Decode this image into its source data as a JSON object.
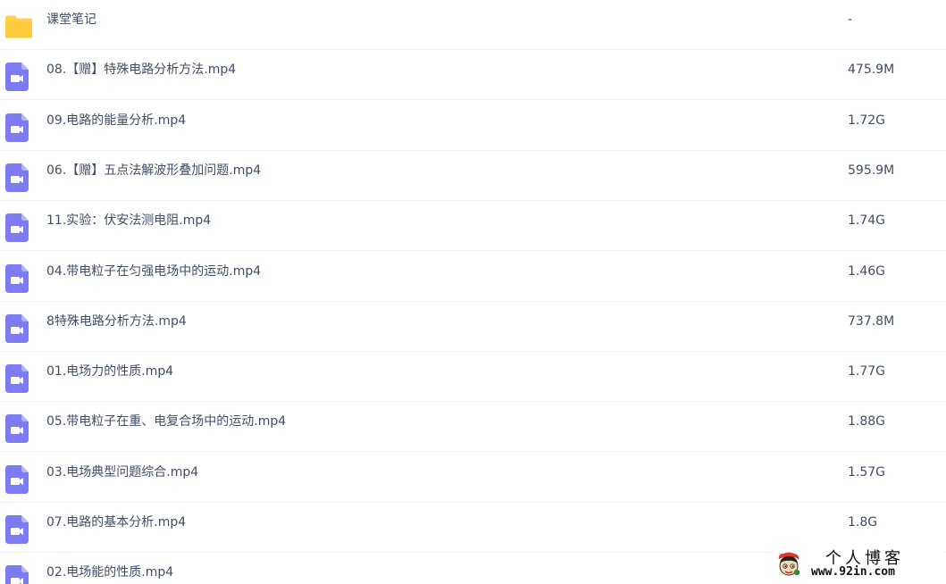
{
  "colors": {
    "folder": "#ffd24d",
    "video": "#7c7bf2",
    "text": "#424e67",
    "divider": "#f1f2f4"
  },
  "files": [
    {
      "name": "课堂笔记",
      "size": "-",
      "type": "folder",
      "icon": "folder-icon"
    },
    {
      "name": "08.【赠】特殊电路分析方法.mp4",
      "size": "475.9M",
      "type": "video",
      "icon": "video-file-icon"
    },
    {
      "name": "09.电路的能量分析.mp4",
      "size": "1.72G",
      "type": "video",
      "icon": "video-file-icon"
    },
    {
      "name": "06.【赠】五点法解波形叠加问题.mp4",
      "size": "595.9M",
      "type": "video",
      "icon": "video-file-icon"
    },
    {
      "name": "11.实验：伏安法测电阻.mp4",
      "size": "1.74G",
      "type": "video",
      "icon": "video-file-icon"
    },
    {
      "name": "04.带电粒子在匀强电场中的运动.mp4",
      "size": "1.46G",
      "type": "video",
      "icon": "video-file-icon"
    },
    {
      "name": "8特殊电路分析方法.mp4",
      "size": "737.8M",
      "type": "video",
      "icon": "video-file-icon"
    },
    {
      "name": "01.电场力的性质.mp4",
      "size": "1.77G",
      "type": "video",
      "icon": "video-file-icon"
    },
    {
      "name": "05.带电粒子在重、电复合场中的运动.mp4",
      "size": "1.88G",
      "type": "video",
      "icon": "video-file-icon"
    },
    {
      "name": "03.电场典型问题综合.mp4",
      "size": "1.57G",
      "type": "video",
      "icon": "video-file-icon"
    },
    {
      "name": "07.电路的基本分析.mp4",
      "size": "1.8G",
      "type": "video",
      "icon": "video-file-icon"
    },
    {
      "name": "02.电场能的性质.mp4",
      "size": "",
      "type": "video",
      "icon": "video-file-icon"
    }
  ],
  "watermark": {
    "title": "个人博客",
    "url": "www.92in.com"
  }
}
